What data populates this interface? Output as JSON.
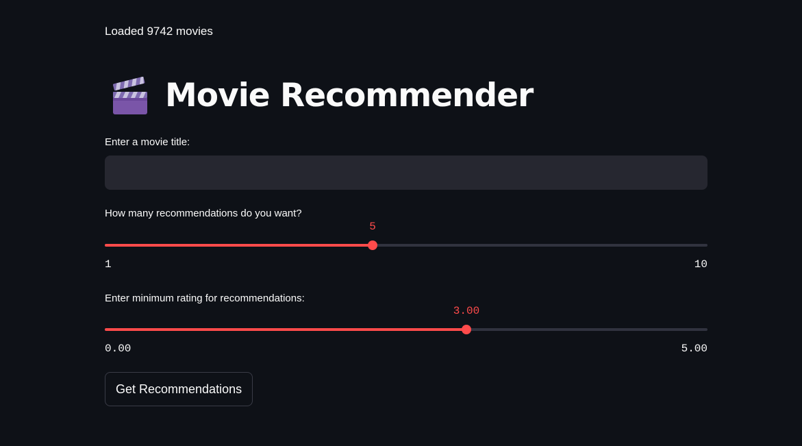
{
  "status": {
    "text": "Loaded 9742 movies"
  },
  "header": {
    "icon": "clapper-board-icon",
    "title": "Movie Recommender"
  },
  "movie_input": {
    "label": "Enter a movie title:",
    "value": "",
    "placeholder": ""
  },
  "num_recs_slider": {
    "label": "How many recommendations do you want?",
    "value": 5,
    "value_text": "5",
    "min": 1,
    "max": 10,
    "min_text": "1",
    "max_text": "10"
  },
  "rating_slider": {
    "label": "Enter minimum rating for recommendations:",
    "value": 3.0,
    "value_text": "3.00",
    "min": 0.0,
    "max": 5.0,
    "min_text": "0.00",
    "max_text": "5.00"
  },
  "submit_button": {
    "label": "Get Recommendations"
  },
  "colors": {
    "background": "#0e1117",
    "accent": "#ff4b4b",
    "input_bg": "#262730",
    "track": "#31333f"
  }
}
